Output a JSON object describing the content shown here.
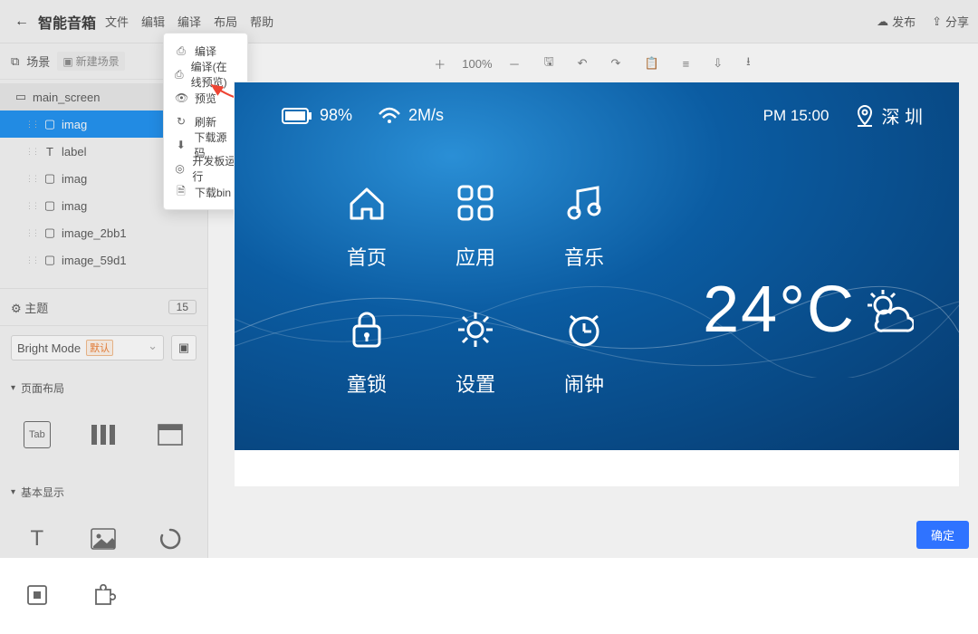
{
  "menubar": {
    "title": "智能音箱",
    "items": [
      "文件",
      "编辑",
      "编译",
      "布局",
      "帮助"
    ],
    "publish": "发布",
    "share": "分享"
  },
  "scene": {
    "label": "场景",
    "new_button": "新建场景"
  },
  "tree": {
    "scene_name": "main_screen",
    "items": [
      "imag",
      "label",
      "imag",
      "imag",
      "image_2bb1",
      "image_59d1"
    ]
  },
  "theme": {
    "label": "主题",
    "count": "15",
    "mode": "Bright Mode",
    "default_tag": "默认"
  },
  "sections": {
    "page_layout": "页面布局",
    "basic_display": "基本显示"
  },
  "dropdown": {
    "compile": "编译",
    "compile_preview": "编译(在线预览)",
    "preview": "预览",
    "refresh": "刷新",
    "download_src": "下载源码",
    "board_run": "开发板运行",
    "download_bin": "下载bin"
  },
  "toolbar": {
    "zoom": "100%"
  },
  "device": {
    "battery": "98%",
    "wifi_speed": "2M/s",
    "time": "PM 15:00",
    "city": "深 圳",
    "temp": "24°C",
    "grid": {
      "home": "首页",
      "apps": "应用",
      "music": "音乐",
      "child_lock": "童锁",
      "settings": "设置",
      "alarm": "闹钟"
    }
  },
  "confirm": "确定"
}
